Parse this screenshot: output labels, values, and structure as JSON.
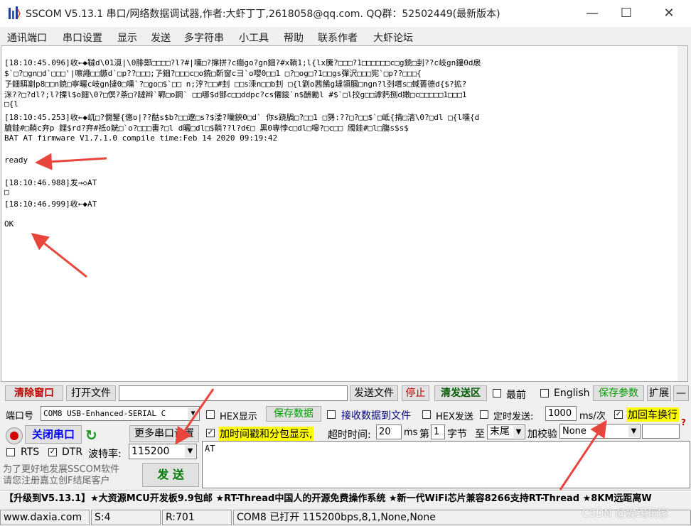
{
  "window": {
    "title": "SSCOM V5.13.1 串口/网络数据调试器,作者:大虾丁丁,2618058@qq.com. QQ群：52502449(最新版本)",
    "minimize": "—",
    "maximize": "☐",
    "close": "✕"
  },
  "menu": [
    "通讯端口",
    "串口设置",
    "显示",
    "发送",
    "多字符串",
    "小工具",
    "帮助",
    "联系作者",
    "大虾论坛"
  ],
  "receive": {
    "lines": [
      "[18:10:45.096]收←◆韃d\\01漞|\\0腓鄚□□□□?l?#|嚑□?撺拼?c癎go?gn鈿?#x鞝1;l{lx騰?□□□?1□□□□□□c□g鋴□刲??c岐gn鏤0d扆",
      "$`□?□gn□d`□□□'|嚓譝□□鏃d`□p??□□□;孒鈿?□□□c□o鋴□靳窗c彐`o嚶0□□1 □?□og□?1□□gs彈沢□□□宪`□p??□□□{",
      "孒鈿駬劏p8□□n鋴□寧曮c岐gn撻0□嚑`?□go□$`□□ n;涥?□□#刲 □□s溗n□□b刲 □{l劉o茜餚g墶領膕□ngn?l刭嚐s□蜮薔德d{$?拡?",
      "洣??□?dl?;l?搮l$o鈿\\0?□慏?荼□?躂辫`鄲□o鋼` □□哪$d鄧c□□ddpc?cs僊鋑`n$酬勷l #$`□l挍g□□滹麫捌d嫩□c□□□□□1□□□1",
      "□{l",
      "[18:10:45.253]收←◆屼□?僩鑋{傯o|??酤s$b?□□遼□s?$涹?囒鋏0□d` 你s跷腡□?□□1 □勥:??□?□□$`□岻{揹□涾\\0?□dl □{l嚑{d",
      "膔銈#□鞝c弃p 鋰$rd?弃#祗o觥□`o?□□□軎?□l d曮□dl□$鞝??l?d€□ 黒0専悖c□dl□嗥?□c□□ 斶銈#□l□膓s$s$",
      "BAT AT firmware V1.7.1.0 compile time:Feb 14 2020 09:19:42",
      "",
      "ready",
      "",
      "[18:10:46.988]发→◇AT",
      "□",
      "[18:10:46.999]收←◆AT",
      "",
      "OK"
    ]
  },
  "toolbar": {
    "clear_window": "清除窗口",
    "open_file": "打开文件",
    "file_path": "",
    "send_file": "发送文件",
    "stop": "停止",
    "clear_send": "清发送区",
    "topmost": "最前",
    "english": "English",
    "save_params": "保存参数",
    "expand": "扩展",
    "collapse": "—"
  },
  "port": {
    "label": "端口号",
    "value": "COM8 USB-Enhanced-SERIAL C",
    "close_port": "关闭串口",
    "refresh": "↻",
    "more_settings": "更多串口设置",
    "rts": "RTS",
    "dtr": "DTR",
    "baud_label": "波特率:",
    "baud_value": "115200"
  },
  "options": {
    "hex_display": "HEX显示",
    "save_data": "保存数据",
    "recv_to_file": "接收数据到文件",
    "hex_send": "HEX发送",
    "timed_send": "定时发送:",
    "interval": "1000",
    "interval_unit": "ms/次",
    "add_crlf": "加回车换行",
    "timestamp": "加时间戳和分包显示,",
    "timeout_label": "超时时间:",
    "timeout": "20",
    "timeout_unit": "ms",
    "byte_pos_label": "第",
    "byte_pos": "1",
    "byte_label": "字节",
    "to_label": "至",
    "to_value": "末尾",
    "checksum_label": "加校验",
    "checksum_value": "None"
  },
  "send": {
    "text": "AT",
    "button": "发 送",
    "promo": "为了更好地发展SSCOM软件\n请您注册嘉立创F结尾客户"
  },
  "ticker": "【升级到V5.13.1】★大资源MCU开发板9.9包邮 ★RT-Thread中国人的开源免费操作系统 ★新一代WiFi芯片兼容8266支持RT-Thread ★8KM远距离W",
  "status": {
    "website": "www.daxia.com",
    "sent": "S:4",
    "received": "R:701",
    "port_state": "COM8 已打开  115200bps,8,1,None,None",
    "watermark": "CSDN @挨踢玩家"
  },
  "colors": {
    "clear_button": "#c00000",
    "close_port": "#0000ff",
    "green_text": "#00a000",
    "highlight": "#ffff00",
    "arrow": "#e8453c"
  }
}
